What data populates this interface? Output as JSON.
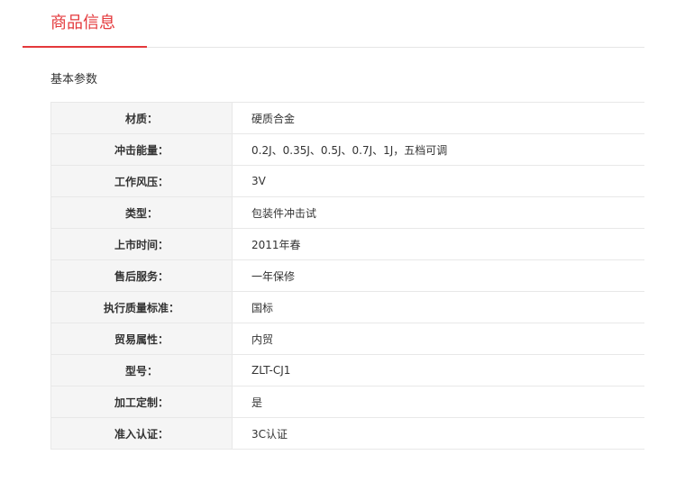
{
  "tabs": {
    "active_label": "商品信息"
  },
  "section": {
    "title": "基本参数"
  },
  "specs": [
    {
      "key": "材质：",
      "value": "硬质合金"
    },
    {
      "key": "冲击能量：",
      "value": "0.2J、0.35J、0.5J、0.7J、1J，五档可调"
    },
    {
      "key": "工作风压：",
      "value": "3V"
    },
    {
      "key": "类型：",
      "value": "包装件冲击试"
    },
    {
      "key": "上市时间：",
      "value": "2011年春"
    },
    {
      "key": "售后服务：",
      "value": "一年保修"
    },
    {
      "key": "执行质量标准：",
      "value": "国标"
    },
    {
      "key": "贸易属性：",
      "value": "内贸"
    },
    {
      "key": "型号：",
      "value": "ZLT-CJ1"
    },
    {
      "key": "加工定制：",
      "value": "是"
    },
    {
      "key": "准入认证：",
      "value": "3C认证"
    }
  ],
  "colors": {
    "accent": "#e4393c",
    "key_background": "#f5f5f5",
    "border": "#e8e8e8"
  }
}
